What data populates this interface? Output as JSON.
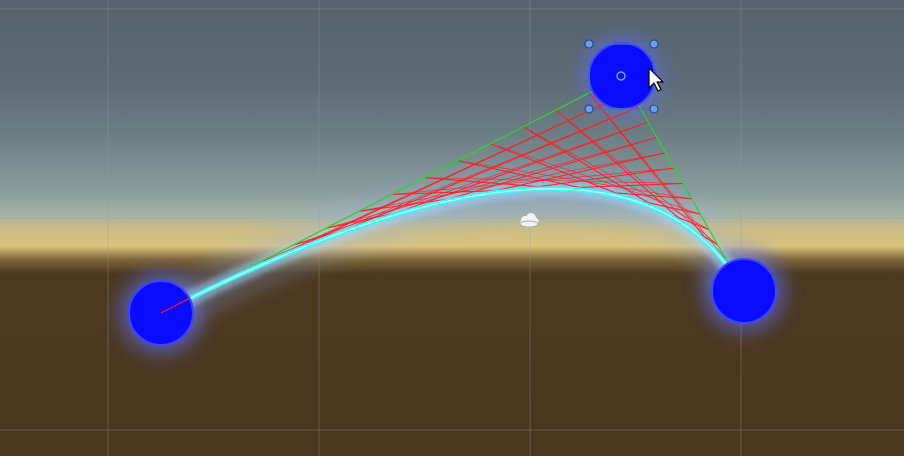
{
  "scene_view": {
    "colors": {
      "sky_top": "#58646e",
      "sky_mid": "#6e7f86",
      "sky_low": "#93a6a6",
      "horizon_glow": "#d4bf7a",
      "ground": "#4b381f",
      "grid_line": "#9a9a9a",
      "node_fill": "#0b0bff",
      "node_glow": "#5b6cff",
      "curve_core": "#3ff3f6",
      "curve_glow": "#8fc2ff",
      "control_line": "#2fd12f",
      "construction_line": "#ff1e1e",
      "handle_fill": "#6aa0e8",
      "handle_outline": "#1f3f8a"
    },
    "nodes": [
      {
        "name": "left-anchor-node"
      },
      {
        "name": "control-point-node"
      },
      {
        "name": "right-anchor-node"
      }
    ],
    "icons": {
      "cursor": "mouse-pointer-icon",
      "light": "light-gizmo-icon",
      "handles": "rect-transform-handle-icon"
    },
    "construction_steps": 14
  }
}
